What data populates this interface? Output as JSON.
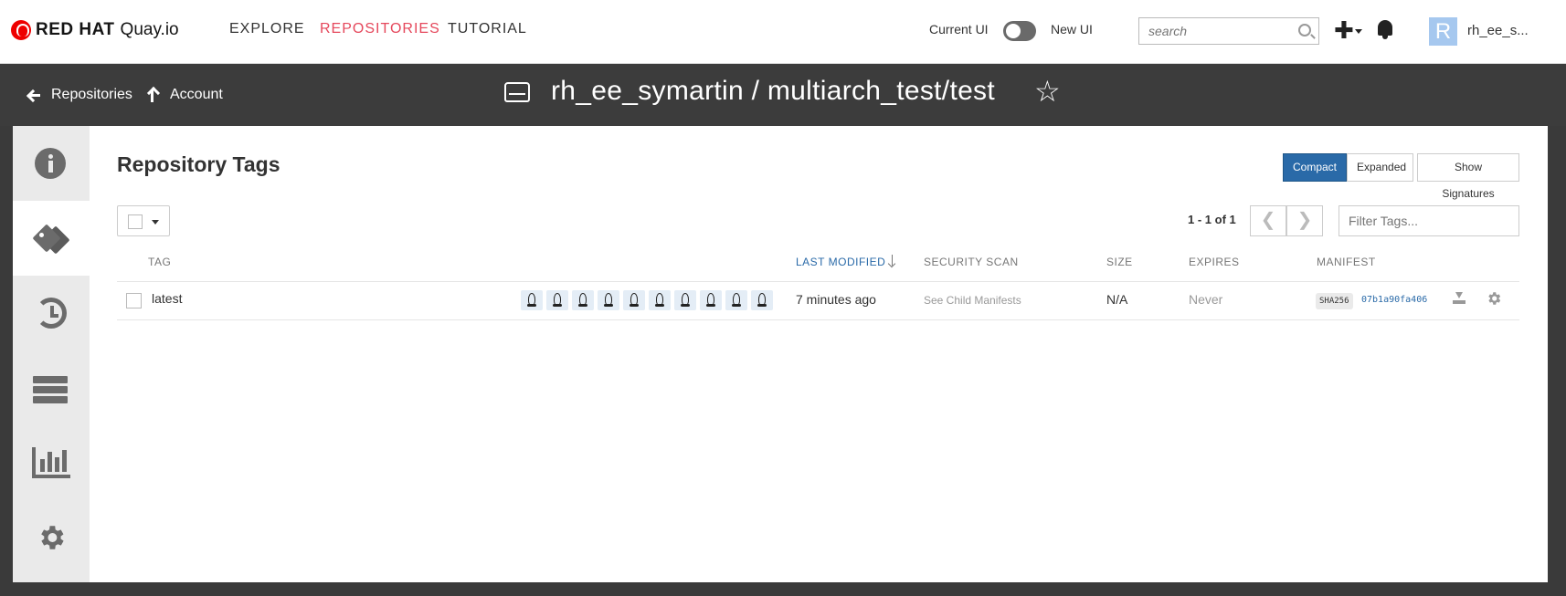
{
  "brand": {
    "name": "RED HAT",
    "product": "Quay.io"
  },
  "nav": {
    "explore": "EXPLORE",
    "repositories": "REPOSITORIES",
    "tutorial": "TUTORIAL"
  },
  "ui_toggle": {
    "current": "Current UI",
    "new": "New UI"
  },
  "search": {
    "placeholder": "search"
  },
  "user": {
    "avatar_letter": "R",
    "name": "rh_ee_s..."
  },
  "header": {
    "back_link": "Repositories",
    "account_link": "Account",
    "repo_title": "rh_ee_symartin / multiarch_test/test"
  },
  "sidebar": {
    "items": [
      {
        "name": "info",
        "icon": "info-icon"
      },
      {
        "name": "tags",
        "icon": "tags-icon",
        "active": true
      },
      {
        "name": "history",
        "icon": "history-icon"
      },
      {
        "name": "builds",
        "icon": "builds-icon"
      },
      {
        "name": "usage-logs",
        "icon": "bar-chart-icon"
      },
      {
        "name": "settings",
        "icon": "gear-icon"
      }
    ]
  },
  "content": {
    "title": "Repository Tags",
    "view_buttons": {
      "compact": "Compact",
      "expanded": "Expanded",
      "signatures": "Show Signatures"
    },
    "page_count": "1 - 1 of 1",
    "filter_placeholder": "Filter Tags...",
    "columns": {
      "tag": "TAG",
      "last_modified": "LAST MODIFIED",
      "security_scan": "SECURITY SCAN",
      "size": "SIZE",
      "expires": "EXPIRES",
      "manifest": "MANIFEST"
    },
    "rows": [
      {
        "tag": "latest",
        "arch_count": 10,
        "last_modified": "7 minutes ago",
        "security_scan": "See Child Manifests",
        "size": "N/A",
        "expires": "Never",
        "manifest_algo": "SHA256",
        "manifest_digest": "07b1a90fa406"
      }
    ]
  },
  "colors": {
    "accent": "#2a6aa8",
    "nav_active": "#e5485c",
    "header_bg": "#3c3c3c"
  }
}
